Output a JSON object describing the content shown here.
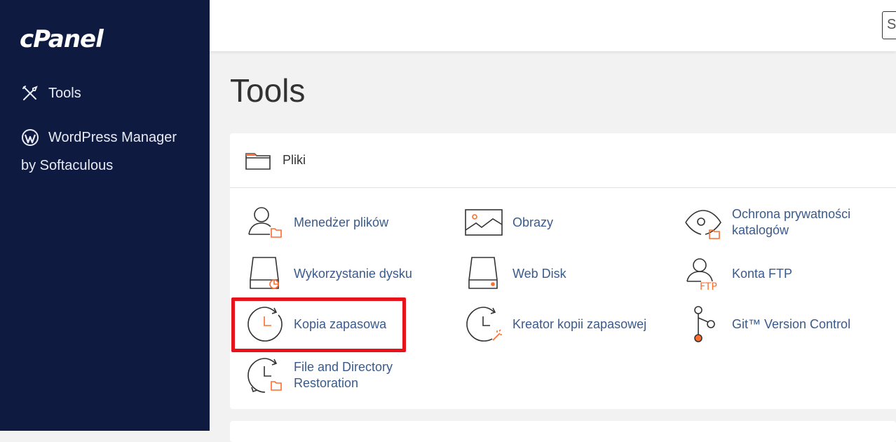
{
  "sidebar": {
    "logo": "cPanel",
    "items": [
      {
        "label": "Tools",
        "icon": "tools-icon"
      },
      {
        "label_line1": "WordPress Manager",
        "label_line2": "by Softaculous",
        "icon": "wordpress-icon"
      }
    ]
  },
  "header": {
    "search_value": "S"
  },
  "page": {
    "title": "Tools"
  },
  "group": {
    "title": "Pliki",
    "icon": "folder-icon",
    "tools": [
      {
        "label": "Menedżer plików",
        "icon": "file-manager-icon"
      },
      {
        "label": "Obrazy",
        "icon": "images-icon"
      },
      {
        "label_line1": "Ochrona prywatności",
        "label_line2": "katalogów",
        "icon": "directory-privacy-icon"
      },
      {
        "label": "Wykorzystanie dysku",
        "icon": "disk-usage-icon"
      },
      {
        "label": "Web Disk",
        "icon": "web-disk-icon"
      },
      {
        "label": "Konta FTP",
        "icon": "ftp-accounts-icon",
        "badge": "FTP"
      },
      {
        "label": "Kopia zapasowa",
        "icon": "backup-icon"
      },
      {
        "label": "Kreator kopii zapasowej",
        "icon": "backup-wizard-icon"
      },
      {
        "label": "Git™ Version Control",
        "icon": "git-icon"
      },
      {
        "label_line1": "File and Directory",
        "label_line2": "Restoration",
        "icon": "file-restoration-icon"
      }
    ]
  },
  "colors": {
    "sidebar_bg": "#0e1a40",
    "accent_orange": "#ff6c2c",
    "link_blue": "#3a5a8c",
    "highlight_red": "#e8121b"
  }
}
